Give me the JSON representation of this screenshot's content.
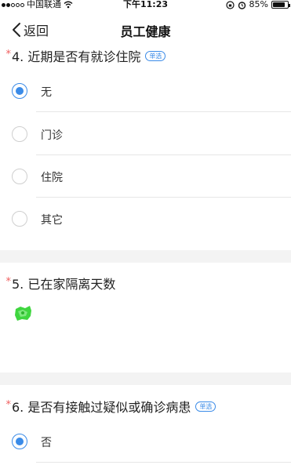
{
  "status_bar": {
    "carrier": "中国联通",
    "time": "下午11:23",
    "battery_text": "85%",
    "battery_level": 0.85
  },
  "nav": {
    "back_label": "返回",
    "title": "员工健康"
  },
  "questions": [
    {
      "number_title": "4. 近期是否有就诊住院",
      "required_mark": "*",
      "type_badge": "单选",
      "options": [
        {
          "label": "无",
          "selected": true
        },
        {
          "label": "门诊",
          "selected": false
        },
        {
          "label": "住院",
          "selected": false
        },
        {
          "label": "其它",
          "selected": false
        }
      ]
    },
    {
      "number_title": "5. 已在家隔离天数",
      "required_mark": "*",
      "answer_color": "#3fd63f"
    },
    {
      "number_title": "6. 是否有接触过疑似或确诊病患",
      "required_mark": "*",
      "type_badge": "单选",
      "options": [
        {
          "label": "否",
          "selected": true
        }
      ]
    }
  ],
  "colors": {
    "accent": "#3a8be8",
    "required": "#f06060",
    "section_gap": "#f3f3f3"
  }
}
